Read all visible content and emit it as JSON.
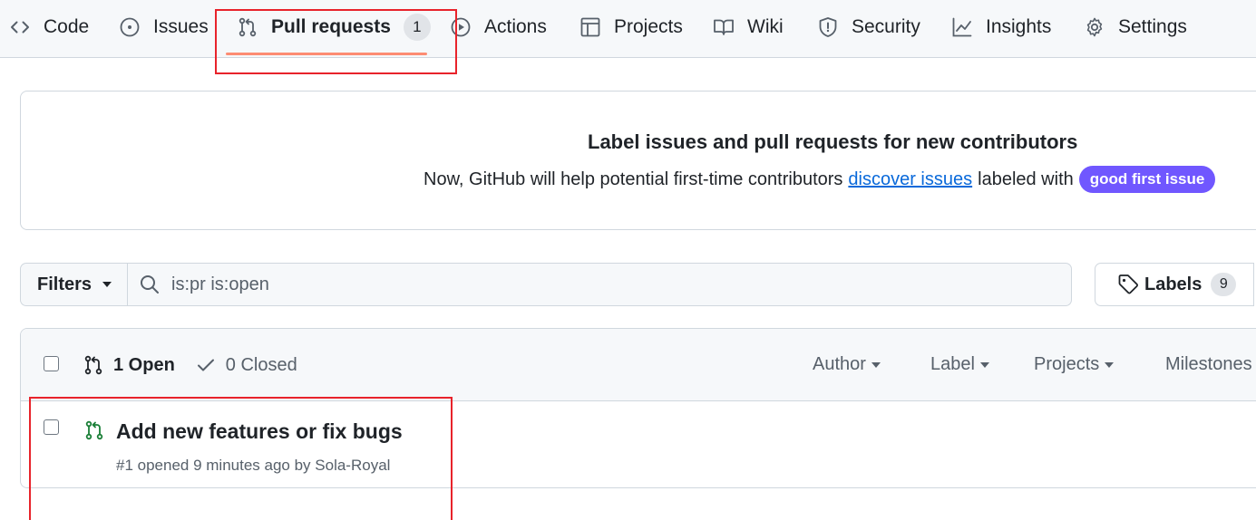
{
  "nav": {
    "tabs": [
      {
        "label": "Code",
        "icon": "code-icon"
      },
      {
        "label": "Issues",
        "icon": "issue-opened-icon"
      },
      {
        "label": "Pull requests",
        "icon": "git-pull-request-icon",
        "count": "1",
        "active": true
      },
      {
        "label": "Actions",
        "icon": "play-icon"
      },
      {
        "label": "Projects",
        "icon": "table-icon"
      },
      {
        "label": "Wiki",
        "icon": "book-icon"
      },
      {
        "label": "Security",
        "icon": "shield-icon"
      },
      {
        "label": "Insights",
        "icon": "graph-icon"
      },
      {
        "label": "Settings",
        "icon": "gear-icon"
      }
    ],
    "underline_color": "#fd8c73"
  },
  "banner": {
    "title": "Label issues and pull requests for new contributors",
    "text_before": "Now, GitHub will help potential first-time contributors",
    "link_text": "discover issues",
    "text_after": "labeled with",
    "label": "good first issue",
    "label_color": "#7057ff"
  },
  "filters": {
    "button_label": "Filters",
    "search_value": "is:pr is:open",
    "labels_label": "Labels",
    "labels_count": "9"
  },
  "list": {
    "open_label": "1 Open",
    "closed_label": "0 Closed",
    "sort": [
      "Author",
      "Label",
      "Projects",
      "Milestones"
    ],
    "items": [
      {
        "title": "Add new features or fix bugs",
        "meta": "#1 opened 9 minutes ago by Sola-Royal",
        "icon": "git-pull-request-icon",
        "icon_color": "#1a7f37"
      }
    ]
  },
  "highlight_color": "#e8232b"
}
